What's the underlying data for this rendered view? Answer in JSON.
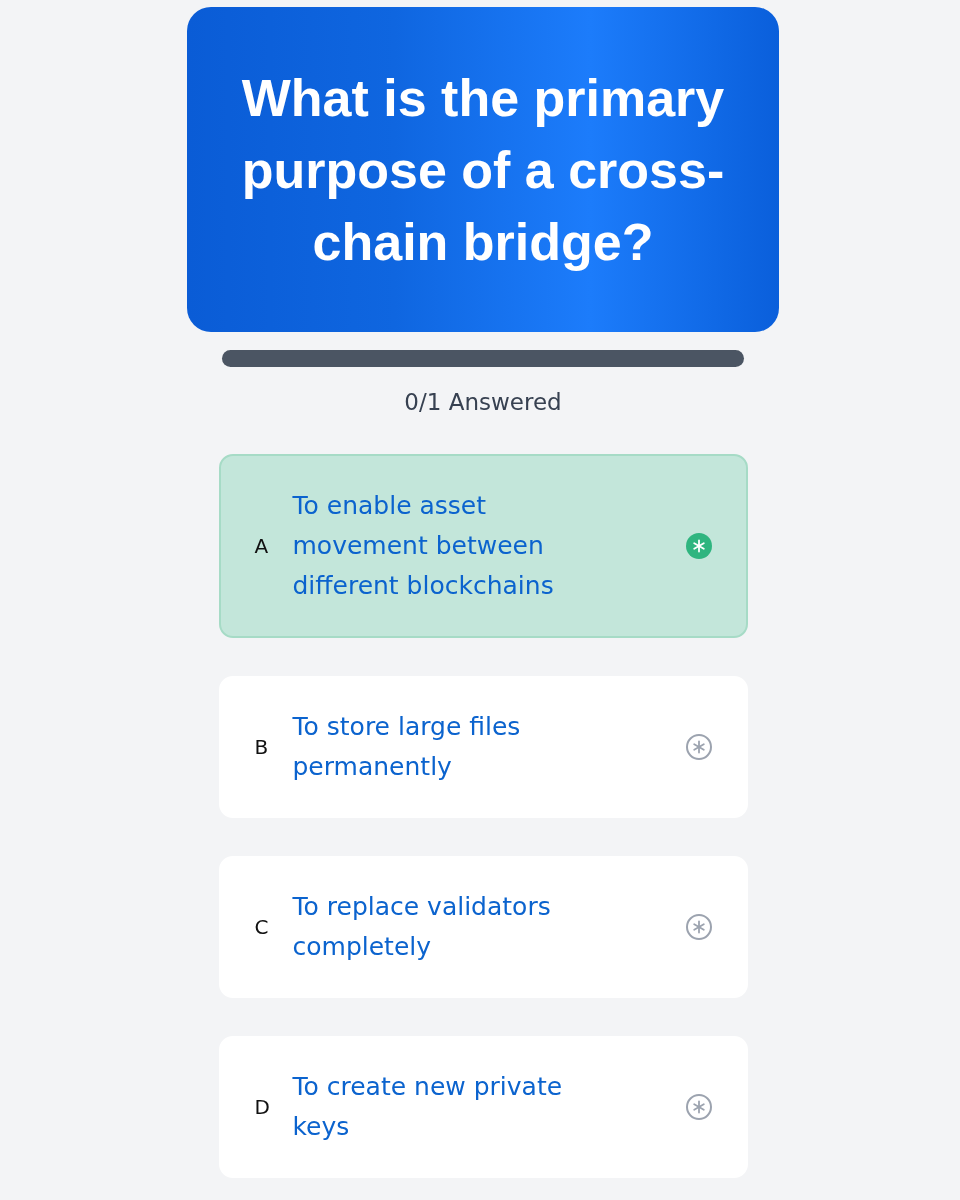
{
  "question": {
    "text": "What is the primary purpose of a cross-chain bridge?"
  },
  "progress": {
    "level": 0,
    "label": "0/1 Answered"
  },
  "options": [
    {
      "letter": "A",
      "text": "To enable asset movement between different blockchains",
      "selected": true
    },
    {
      "letter": "B",
      "text": "To store large files permanently",
      "selected": false
    },
    {
      "letter": "C",
      "text": "To replace validators completely",
      "selected": false
    },
    {
      "letter": "D",
      "text": "To create new private keys",
      "selected": false
    }
  ]
}
